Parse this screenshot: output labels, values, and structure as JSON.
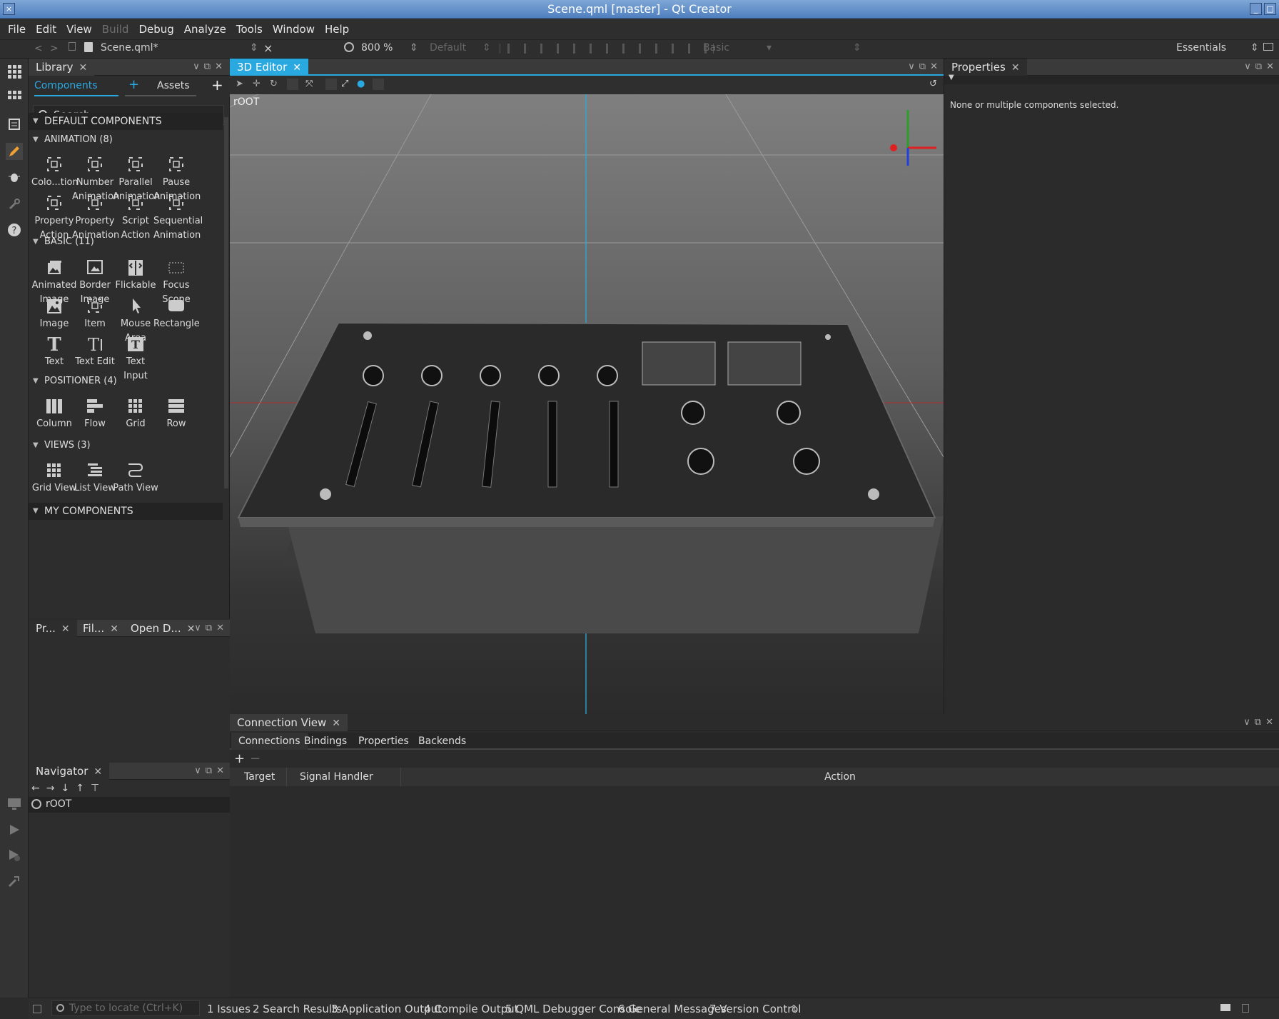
{
  "window": {
    "title": "Scene.qml [master] - Qt Creator"
  },
  "menu": [
    "File",
    "Edit",
    "View",
    "Build",
    "Debug",
    "Analyze",
    "Tools",
    "Window",
    "Help"
  ],
  "menu_disabled": [
    "Build"
  ],
  "toolbar": {
    "file": "Scene.qml*",
    "zoom": "800 %",
    "state": "Default",
    "style": "Basic",
    "mode": "Essentials"
  },
  "library": {
    "tab": "Library",
    "subtabs": {
      "components": "Components",
      "assets": "Assets"
    },
    "search_placeholder": "Search",
    "default_components": "DEFAULT COMPONENTS",
    "my_components": "MY COMPONENTS",
    "categories": [
      {
        "title": "ANIMATION (8)",
        "items": [
          "Colo...tion",
          "Number Animation",
          "Parallel Animation",
          "Pause Animation",
          "Property Action",
          "Property Animation",
          "Script Action",
          "Sequential Animation"
        ]
      },
      {
        "title": "BASIC (11)",
        "items": [
          "Animated Image",
          "Border Image",
          "Flickable",
          "Focus Scope",
          "Image",
          "Item",
          "Mouse Area",
          "Rectangle",
          "Text",
          "Text Edit",
          "Text Input"
        ]
      },
      {
        "title": "POSITIONER (4)",
        "items": [
          "Column",
          "Flow",
          "Grid",
          "Row"
        ]
      },
      {
        "title": "VIEWS (3)",
        "items": [
          "Grid View",
          "List View",
          "Path View"
        ]
      }
    ]
  },
  "bottom_left_tabs": [
    "Pr...",
    "Fil...",
    "Open D..."
  ],
  "navigator": {
    "tab": "Navigator",
    "root": "rOOT"
  },
  "editor": {
    "tab": "3D Editor",
    "root_label": "rOOT"
  },
  "properties": {
    "tab": "Properties",
    "message": "None or multiple components selected."
  },
  "connection_view": {
    "tab": "Connection View",
    "subtabs": [
      "Connections",
      "Bindings",
      "Properties",
      "Backends"
    ],
    "columns": [
      "Target",
      "Signal Handler",
      "Action"
    ]
  },
  "statusbar": {
    "locate_placeholder": "Type to locate (Ctrl+K)",
    "panes": [
      "1  Issues",
      "2  Search Results",
      "3  Application Output",
      "4  Compile Output",
      "5  QML Debugger Console",
      "6  General Messages",
      "7  Version Control"
    ]
  },
  "colors": {
    "accent": "#2aa9e0",
    "viewport_top": "#7f7f7f",
    "panel": "#2d2d2d"
  }
}
